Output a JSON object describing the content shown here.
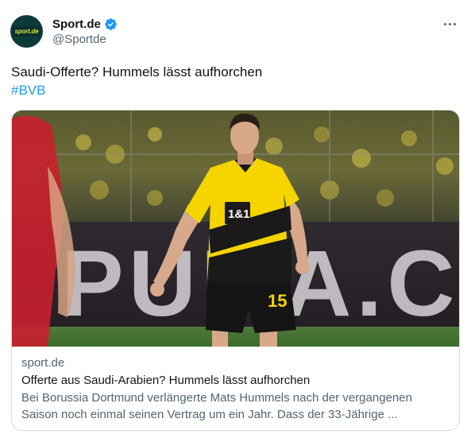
{
  "account": {
    "name": "Sport.de",
    "handle": "@Sportde",
    "avatar_text": "sport.de",
    "verified_icon": "verified-badge-icon"
  },
  "tweet": {
    "text": "Saudi-Offerte? Hummels lässt aufhorchen",
    "hashtag": "#BVB"
  },
  "card": {
    "domain": "sport.de",
    "title": "Offerte aus Saudi-Arabien? Hummels lässt aufhorchen",
    "description": "Bei Borussia Dortmund verlängerte Mats Hummels nach der vergangenen Saison noch einmal seinen Vertrag um ein Jahr. Dass der 33-Jährige ...",
    "image_overlay": {
      "board_text": "PUMA.CO",
      "sponsor": "1&1",
      "shirt_number": "15"
    }
  },
  "colors": {
    "accent": "#1d9bf0",
    "text": "#0f1419",
    "secondary": "#536471",
    "border": "#cfd9de",
    "bvb_yellow": "#f5d400"
  }
}
